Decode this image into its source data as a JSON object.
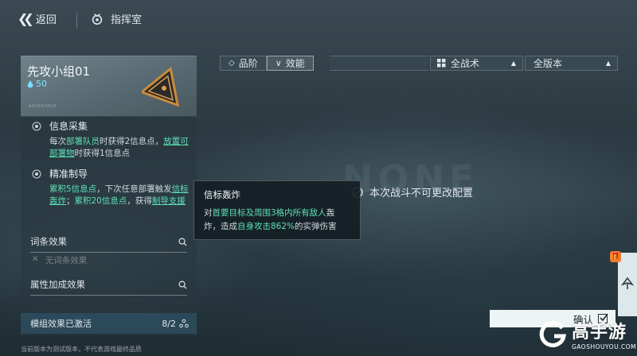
{
  "nav": {
    "back_label": "返回",
    "command_label": "指挥室"
  },
  "card": {
    "title": "先攻小组01",
    "cost": "50",
    "subtitle": "ADVANTAGE"
  },
  "skills": [
    {
      "name": "信息采集",
      "desc_parts": [
        "每次",
        "部署队员",
        "时获得2信息点，",
        "放置可部署物",
        "时获得1信息点"
      ]
    },
    {
      "name": "精准制导",
      "desc_parts": [
        "累积5信息点",
        "，下次任意部署触发",
        "信标轰炸",
        "；",
        "累积20信息点",
        "，获得",
        "制导支援"
      ]
    }
  ],
  "fields": {
    "entry_effect_label": "词条效果",
    "no_entry_label": "无词条效果",
    "attr_bonus_label": "属性加成效果"
  },
  "active_bar": {
    "label": "模组效果已激活",
    "count": "8/2"
  },
  "footnote": "当前版本为测试版本，不代表游戏最终品质",
  "tooltip": {
    "title": "信标轰炸",
    "body_parts": [
      "对",
      "首要目标及周围3格内所有敌人",
      "轰炸，造成",
      "自身攻击862%",
      "的实弹伤害"
    ]
  },
  "filters": {
    "tabs": [
      {
        "label": "品阶",
        "icon": "diamond-icon"
      },
      {
        "label": "效能",
        "icon": "chevron-down-icon"
      }
    ],
    "tactic_select": "全战术",
    "version_select": "全版本"
  },
  "content": {
    "locked_message": "本次战斗不可更改配置",
    "background_text": "NONE"
  },
  "confirm_label": "确认",
  "brand": {
    "name_cn": "高手游",
    "name_en": "GAOSHOUYOU.COM"
  },
  "colors": {
    "accent_green": "#5de0b4",
    "cost_blue": "#79e0ff"
  }
}
